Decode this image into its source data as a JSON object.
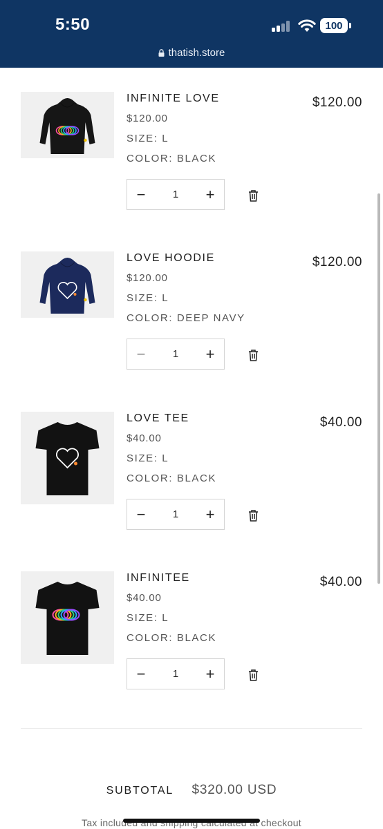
{
  "status": {
    "time": "5:50",
    "battery": "100"
  },
  "browser": {
    "url": "thatish.store"
  },
  "cart": {
    "items": [
      {
        "name": "INFINITE LOVE",
        "unit_price": "$120.00",
        "size": "SIZE: L",
        "color": "COLOR: BLACK",
        "line_total": "$120.00",
        "quantity": "1",
        "garment": "hoodie",
        "garment_color": "#161616",
        "graphic": "infinity"
      },
      {
        "name": "LOVE HOODIE",
        "unit_price": "$120.00",
        "size": "SIZE: L",
        "color": "COLOR: DEEP NAVY",
        "line_total": "$120.00",
        "quantity": "1",
        "garment": "hoodie",
        "garment_color": "#1c2a5c",
        "graphic": "heart"
      },
      {
        "name": "LOVE TEE",
        "unit_price": "$40.00",
        "size": "SIZE: L",
        "color": "COLOR: BLACK",
        "line_total": "$40.00",
        "quantity": "1",
        "garment": "tee",
        "garment_color": "#121212",
        "graphic": "heart"
      },
      {
        "name": "INFINITEE",
        "unit_price": "$40.00",
        "size": "SIZE: L",
        "color": "COLOR: BLACK",
        "line_total": "$40.00",
        "quantity": "1",
        "garment": "tee",
        "garment_color": "#121212",
        "graphic": "infinity"
      }
    ],
    "minus_symbol": "−",
    "plus_symbol": "+",
    "icons": {
      "decrease": "minus-icon",
      "increase": "plus-icon",
      "remove": "trash-icon"
    }
  },
  "summary": {
    "subtotal_label": "SUBTOTAL",
    "subtotal_value": "$320.00 USD",
    "tax_note": "Tax included and shipping calculated at checkout"
  },
  "colors": {
    "status_bar": "#0f3563",
    "text": "#1f1f1f",
    "muted_text": "#555555",
    "border": "#d4d4d4"
  }
}
